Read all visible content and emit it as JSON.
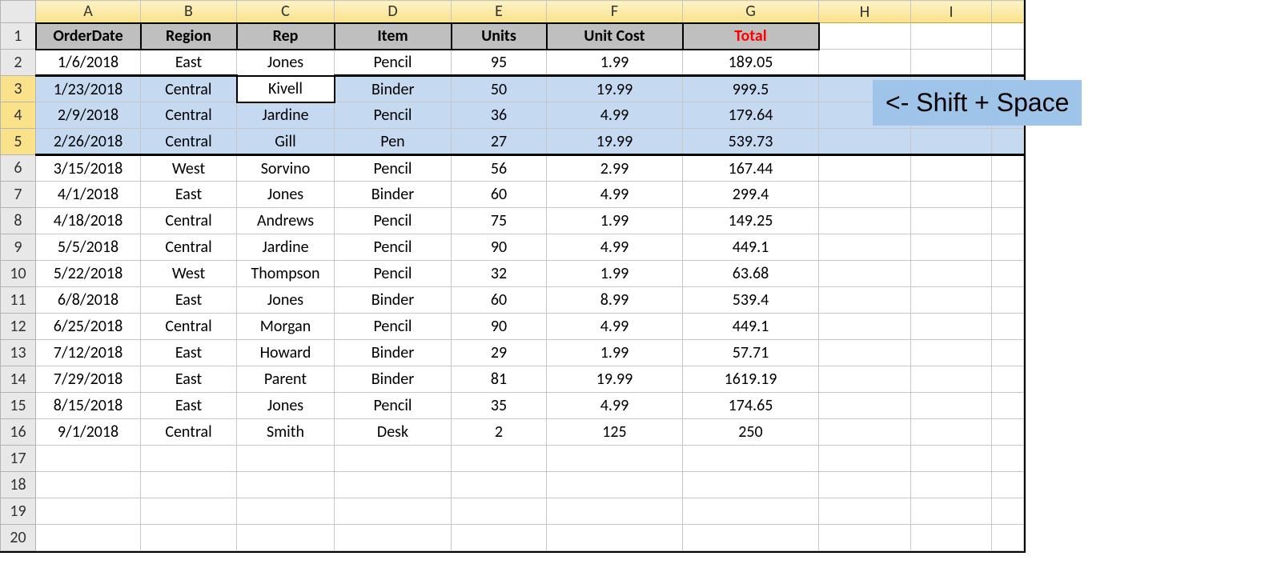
{
  "columns": [
    "A",
    "B",
    "C",
    "D",
    "E",
    "F",
    "G",
    "H",
    "I",
    ""
  ],
  "row_numbers": [
    1,
    2,
    3,
    4,
    5,
    6,
    7,
    8,
    9,
    10,
    11,
    12,
    13,
    14,
    15,
    16,
    17,
    18,
    19,
    20
  ],
  "selected_rows": [
    3,
    4,
    5
  ],
  "active_cell": {
    "row": 3,
    "col": "C"
  },
  "annotation": "<- Shift + Space",
  "header": {
    "A": "OrderDate",
    "B": "Region",
    "C": "Rep",
    "D": "Item",
    "E": "Units",
    "F": "Unit Cost",
    "G": "Total"
  },
  "rows": [
    {
      "A": "1/6/2018",
      "B": "East",
      "C": "Jones",
      "D": "Pencil",
      "E": "95",
      "F": "1.99",
      "G": "189.05"
    },
    {
      "A": "1/23/2018",
      "B": "Central",
      "C": "Kivell",
      "D": "Binder",
      "E": "50",
      "F": "19.99",
      "G": "999.5"
    },
    {
      "A": "2/9/2018",
      "B": "Central",
      "C": "Jardine",
      "D": "Pencil",
      "E": "36",
      "F": "4.99",
      "G": "179.64"
    },
    {
      "A": "2/26/2018",
      "B": "Central",
      "C": "Gill",
      "D": "Pen",
      "E": "27",
      "F": "19.99",
      "G": "539.73"
    },
    {
      "A": "3/15/2018",
      "B": "West",
      "C": "Sorvino",
      "D": "Pencil",
      "E": "56",
      "F": "2.99",
      "G": "167.44"
    },
    {
      "A": "4/1/2018",
      "B": "East",
      "C": "Jones",
      "D": "Binder",
      "E": "60",
      "F": "4.99",
      "G": "299.4"
    },
    {
      "A": "4/18/2018",
      "B": "Central",
      "C": "Andrews",
      "D": "Pencil",
      "E": "75",
      "F": "1.99",
      "G": "149.25"
    },
    {
      "A": "5/5/2018",
      "B": "Central",
      "C": "Jardine",
      "D": "Pencil",
      "E": "90",
      "F": "4.99",
      "G": "449.1"
    },
    {
      "A": "5/22/2018",
      "B": "West",
      "C": "Thompson",
      "D": "Pencil",
      "E": "32",
      "F": "1.99",
      "G": "63.68"
    },
    {
      "A": "6/8/2018",
      "B": "East",
      "C": "Jones",
      "D": "Binder",
      "E": "60",
      "F": "8.99",
      "G": "539.4"
    },
    {
      "A": "6/25/2018",
      "B": "Central",
      "C": "Morgan",
      "D": "Pencil",
      "E": "90",
      "F": "4.99",
      "G": "449.1"
    },
    {
      "A": "7/12/2018",
      "B": "East",
      "C": "Howard",
      "D": "Binder",
      "E": "29",
      "F": "1.99",
      "G": "57.71"
    },
    {
      "A": "7/29/2018",
      "B": "East",
      "C": "Parent",
      "D": "Binder",
      "E": "81",
      "F": "19.99",
      "G": "1619.19"
    },
    {
      "A": "8/15/2018",
      "B": "East",
      "C": "Jones",
      "D": "Pencil",
      "E": "35",
      "F": "4.99",
      "G": "174.65"
    },
    {
      "A": "9/1/2018",
      "B": "Central",
      "C": "Smith",
      "D": "Desk",
      "E": "2",
      "F": "125",
      "G": "250"
    }
  ]
}
